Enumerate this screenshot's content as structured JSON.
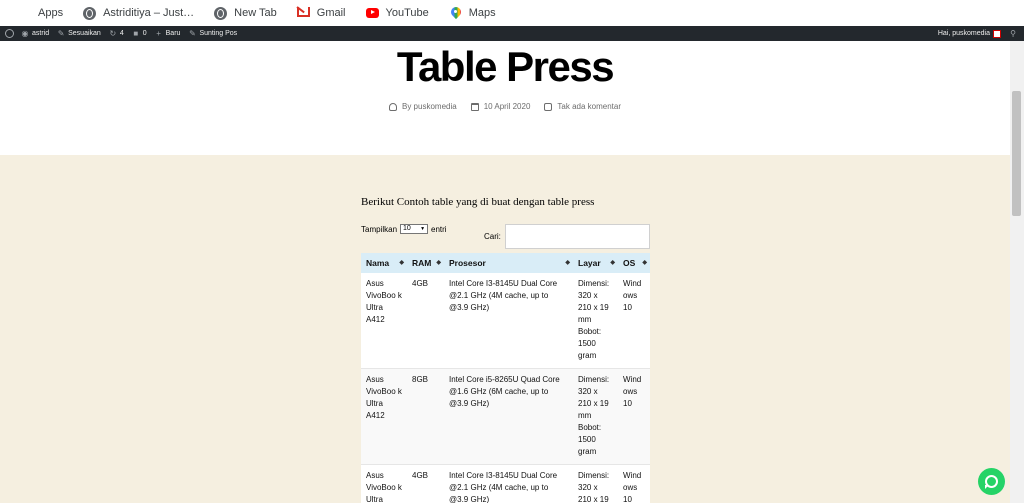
{
  "bookmarks": [
    {
      "label": "Apps",
      "icon": "apps-grid-icon"
    },
    {
      "label": "Astriditiya – Just…",
      "icon": "globe-icon"
    },
    {
      "label": "New Tab",
      "icon": "globe-icon"
    },
    {
      "label": "Gmail",
      "icon": "gmail-icon"
    },
    {
      "label": "YouTube",
      "icon": "youtube-icon"
    },
    {
      "label": "Maps",
      "icon": "maps-icon"
    }
  ],
  "adminbar": {
    "site": "astrid",
    "customize": "Sesuaikan",
    "updates": "4",
    "comments": "0",
    "new": "Baru",
    "edit": "Sunting Pos",
    "greeting": "Hai, puskomedia"
  },
  "post": {
    "title": "Table Press",
    "author": "By puskomedia",
    "date": "10 April 2020",
    "comments": "Tak ada komentar",
    "intro": "Berikut Contoh table yang di buat dengan table press"
  },
  "datatable": {
    "length_prefix": "Tampilkan",
    "length_value": "10",
    "length_suffix": "entri",
    "search_label": "Cari:",
    "search_value": "",
    "columns": [
      "Nama",
      "RAM",
      "Prosesor",
      "Layar",
      "OS"
    ],
    "rows": [
      [
        "Asus VivoBoo k Ultra A412",
        "4GB",
        "Intel Core I3-8145U Dual Core @2.1 GHz (4M cache, up to @3.9 GHz)",
        "Dimensi: 320 x 210 x 19 mm Bobot: 1500 gram",
        "Wind ows 10"
      ],
      [
        "Asus VivoBoo k Ultra A412",
        "8GB",
        "Intel Core i5-8265U Quad Core @1.6 GHz (6M cache, up to @3.9 GHz)",
        "Dimensi: 320 x 210 x 19 mm Bobot: 1500 gram",
        "Wind ows 10"
      ],
      [
        "Asus VivoBoo k Ultra",
        "4GB",
        "Intel Core I3-8145U Dual Core @2.1 GHz (4M cache, up to @3.9 GHz)",
        "Dimensi: 320 x 210 x 19",
        "Wind ows 10"
      ]
    ]
  },
  "colors": {
    "adminbar_bg": "#23282d",
    "content_bg": "#f5efe0",
    "table_header_bg": "#d9edf7",
    "whatsapp": "#25d366"
  }
}
